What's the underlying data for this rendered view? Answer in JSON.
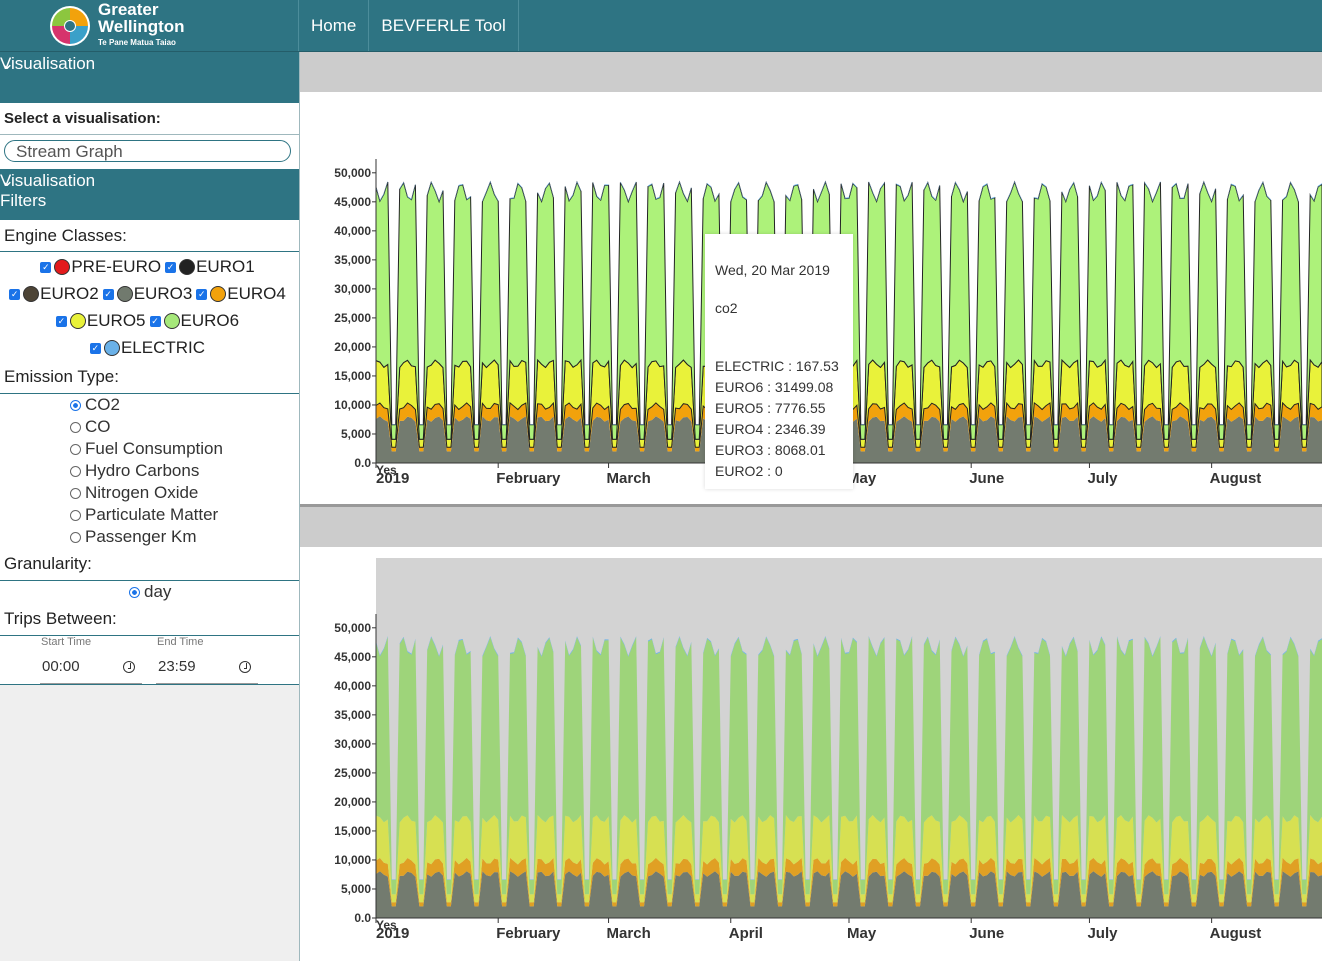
{
  "brand": {
    "line1": "Greater",
    "line2": "Wellington",
    "line3": "Te Pane Matua Taiao"
  },
  "nav": {
    "home": "Home",
    "tool": "BEVFERLE Tool"
  },
  "sidebar": {
    "visualisation_header": "Visualisation",
    "select_label": "Select a visualisation:",
    "select_value": "Stream Graph",
    "filters_header": "Visualisation Filters",
    "engine_label": "Engine Classes:",
    "engine_classes": [
      {
        "label": "PRE-EURO",
        "color": "#e31a1c",
        "checked": true
      },
      {
        "label": "EURO1",
        "color": "#222222",
        "checked": true
      },
      {
        "label": "EURO2",
        "color": "#4d4436",
        "checked": true
      },
      {
        "label": "EURO3",
        "color": "#717a6e",
        "checked": true
      },
      {
        "label": "EURO4",
        "color": "#f2a20c",
        "checked": true
      },
      {
        "label": "EURO5",
        "color": "#e9f23a",
        "checked": true
      },
      {
        "label": "EURO6",
        "color": "#a6e87a",
        "checked": true
      },
      {
        "label": "ELECTRIC",
        "color": "#6ab1e8",
        "checked": true
      }
    ],
    "emission_label": "Emission Type:",
    "emission_types": [
      {
        "label": "CO2",
        "selected": true
      },
      {
        "label": "CO",
        "selected": false
      },
      {
        "label": "Fuel Consumption",
        "selected": false
      },
      {
        "label": "Hydro Carbons",
        "selected": false
      },
      {
        "label": "Nitrogen Oxide",
        "selected": false
      },
      {
        "label": "Particulate Matter",
        "selected": false
      },
      {
        "label": "Passenger Km",
        "selected": false
      }
    ],
    "granularity_label": "Granularity:",
    "granularity_value": "day",
    "trips_label": "Trips Between:",
    "start_time_label": "Start Time",
    "start_time": "00:00",
    "end_time_label": "End Time",
    "end_time": "23:59"
  },
  "tooltip": {
    "date": "Wed, 20 Mar 2019",
    "metric": "co2",
    "rows": [
      "ELECTRIC : 167.53",
      "EURO6 : 31499.08",
      "EURO5 : 7776.55",
      "EURO4 : 2346.39",
      "EURO3 : 8068.01",
      "EURO2 : 0"
    ]
  },
  "chart_data": [
    {
      "type": "area",
      "stacked": true,
      "yticks": [
        "0.0",
        "5,000",
        "10,000",
        "15,000",
        "20,000",
        "25,000",
        "30,000",
        "35,000",
        "40,000",
        "45,000",
        "50,000"
      ],
      "ylim": [
        0,
        51000
      ],
      "xticks": [
        "2019",
        "February",
        "March",
        "April",
        "May",
        "June",
        "July",
        "August"
      ],
      "x_extra_label": "Yes",
      "series": [
        {
          "name": "EURO3",
          "color": "#737b6f",
          "weekday_approx": 8068,
          "weekend_approx": 2000
        },
        {
          "name": "EURO4",
          "color": "#f2a20c",
          "weekday_approx": 2346,
          "weekend_approx": 800
        },
        {
          "name": "EURO5",
          "color": "#e9f23a",
          "weekday_approx": 7777,
          "weekend_approx": 1500
        },
        {
          "name": "EURO6",
          "color": "#adf27a",
          "weekday_approx": 31499,
          "weekend_approx": 2500
        },
        {
          "name": "ELECTRIC",
          "color": "#6ab1e8",
          "weekday_approx": 168,
          "weekend_approx": 50
        }
      ]
    },
    {
      "type": "area",
      "stacked": true,
      "yticks": [
        "0.0",
        "5,000",
        "10,000",
        "15,000",
        "20,000",
        "25,000",
        "30,000",
        "35,000",
        "40,000",
        "45,000",
        "50,000"
      ],
      "ylim": [
        0,
        51000
      ],
      "xticks": [
        "2019",
        "February",
        "March",
        "April",
        "May",
        "June",
        "July",
        "August"
      ],
      "x_extra_label": "Yes",
      "series": [
        {
          "name": "EURO3",
          "color": "#737b6f"
        },
        {
          "name": "EURO4",
          "color": "#e0a024"
        },
        {
          "name": "EURO5",
          "color": "#d7e052"
        },
        {
          "name": "EURO6",
          "color": "#9ed47a"
        },
        {
          "name": "ELECTRIC",
          "color": "#6ab1e8"
        }
      ]
    }
  ]
}
